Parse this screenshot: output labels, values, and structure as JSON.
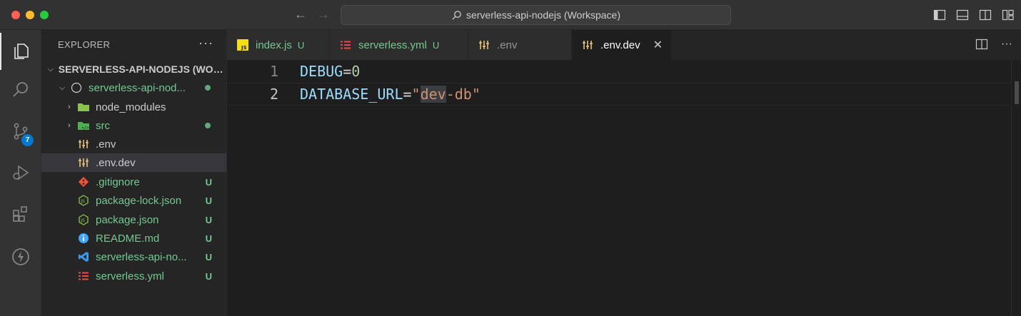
{
  "window": {
    "title": "serverless-api-nodejs (Workspace)"
  },
  "activity": {
    "scm_badge": "7"
  },
  "sidebar": {
    "header": "EXPLORER",
    "more": "···",
    "workspace": "SERVERLESS-API-NODEJS (WOR...",
    "folder": "serverless-api-nod...",
    "items": [
      {
        "label": "node_modules",
        "status": ""
      },
      {
        "label": "src",
        "status": ""
      },
      {
        "label": ".env",
        "status": ""
      },
      {
        "label": ".env.dev",
        "status": ""
      },
      {
        "label": ".gitignore",
        "status": "U"
      },
      {
        "label": "package-lock.json",
        "status": "U"
      },
      {
        "label": "package.json",
        "status": "U"
      },
      {
        "label": "README.md",
        "status": "U"
      },
      {
        "label": "serverless-api-no...",
        "status": "U"
      },
      {
        "label": "serverless.yml",
        "status": "U"
      }
    ]
  },
  "tabs": [
    {
      "label": "index.js",
      "status": "U",
      "icon": "js-icon"
    },
    {
      "label": "serverless.yml",
      "status": "U",
      "icon": "yaml-icon"
    },
    {
      "label": ".env",
      "status": "",
      "icon": "env-icon"
    },
    {
      "label": ".env.dev",
      "status": "",
      "icon": "env-icon",
      "close": "✕"
    }
  ],
  "editor": {
    "lines": [
      {
        "number": "1",
        "key": "DEBUG",
        "eq": "=",
        "value": "0"
      },
      {
        "number": "2",
        "key": "DATABASE_URL",
        "eq": "=",
        "quote_open": "\"",
        "value_hl": "dev",
        "value_rest": "-db",
        "quote_close": "\""
      }
    ]
  },
  "colors": {
    "accent": "#0078d4",
    "untracked": "#73c991",
    "key": "#9cdcfe",
    "string": "#ce9178",
    "number": "#b5cea8"
  }
}
